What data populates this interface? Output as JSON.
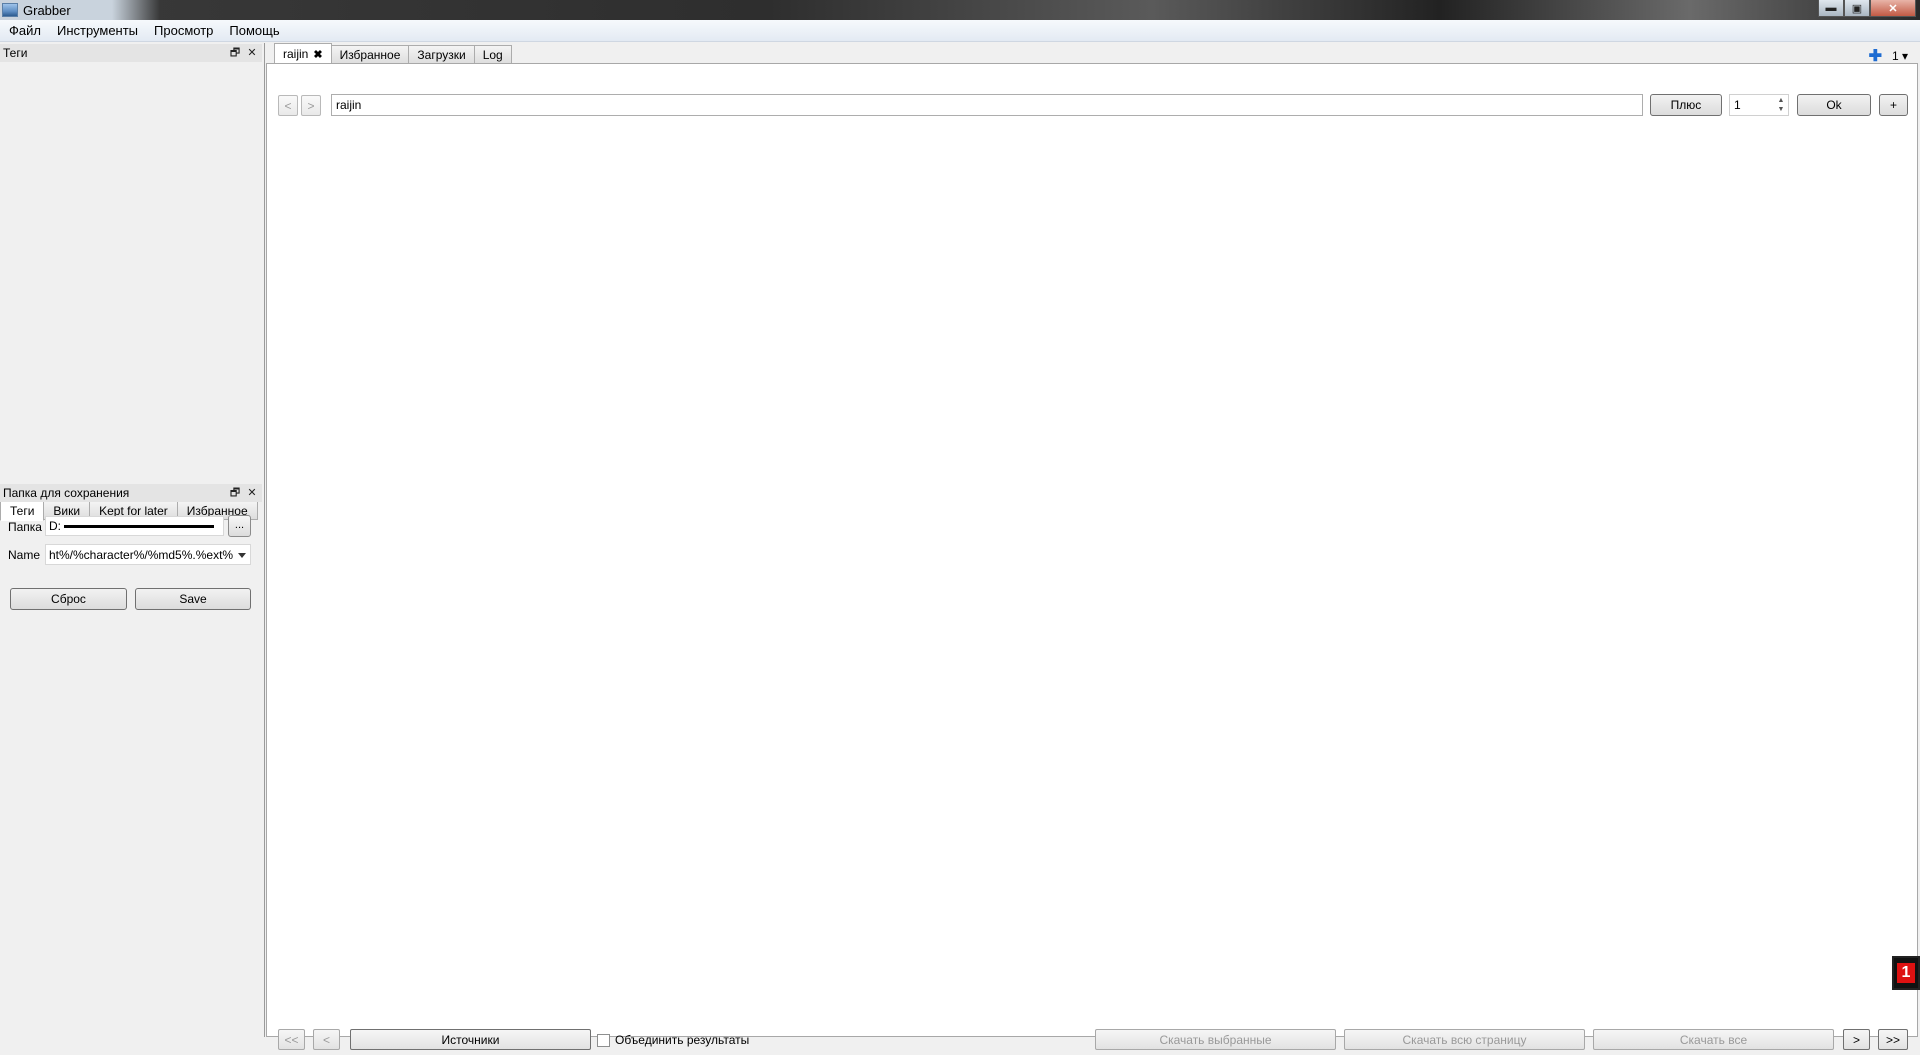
{
  "window": {
    "title": "Grabber",
    "min": "▬",
    "max": "▣",
    "close": "✕"
  },
  "menu": [
    "Файл",
    "Инструменты",
    "Просмотр",
    "Помощь"
  ],
  "left_panel": {
    "tags_dock_title": "Теги",
    "dock_float": "🗗",
    "dock_close": "✕",
    "tabs": [
      "Теги",
      "Вики",
      "Kept for later",
      "Избранное"
    ],
    "save_dock_title": "Папка для сохранения",
    "folder_label": "Папка",
    "folder_value": "D:",
    "browse_label": "...",
    "name_label": "Name",
    "name_value": "ht%/%character%/%md5%.%ext%",
    "reset_label": "Сброс",
    "save_label": "Save"
  },
  "main": {
    "tabs": [
      {
        "label": "raijin",
        "close": "✖"
      },
      {
        "label": "Избранное"
      },
      {
        "label": "Загрузки"
      },
      {
        "label": "Log"
      }
    ],
    "tab_count": "1 ▾",
    "add_tab_icon": "✚",
    "nav_prev": "<",
    "nav_next": ">",
    "search_value": "raijin",
    "plus_button": "Плюс",
    "page_value": "1",
    "ok_button": "Ok",
    "add_button": "+",
    "bottom": {
      "first": "<<",
      "prev": "<",
      "sources": "Источники",
      "merge_label": "Объединить результаты",
      "download_selected": "Скачать выбранные",
      "download_page": "Скачать всю страницу",
      "download_all": "Скачать все",
      "next": ">",
      "last": ">>"
    }
  }
}
